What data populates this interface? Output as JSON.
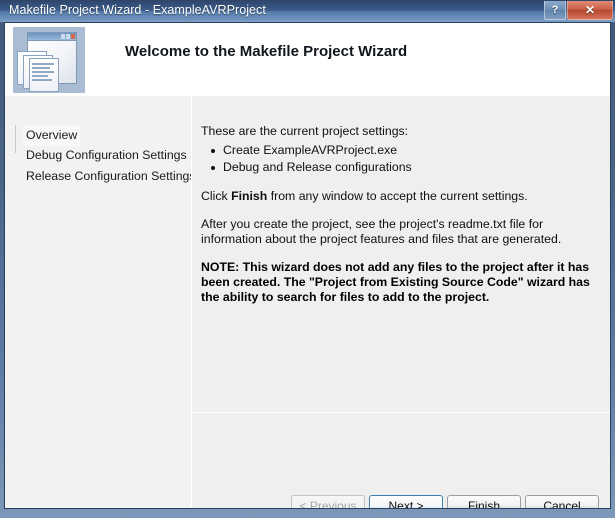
{
  "window": {
    "title": "Makefile Project Wizard - ExampleAVRProject",
    "help_button": "?",
    "close_button": "✕"
  },
  "header": {
    "title": "Welcome to the Makefile Project Wizard",
    "icon": "wizard-window-pages-icon"
  },
  "sidebar": {
    "items": [
      {
        "label": "Overview",
        "selected": true
      },
      {
        "label": "Debug Configuration Settings",
        "selected": false
      },
      {
        "label": "Release Configuration Settings",
        "selected": false
      }
    ]
  },
  "content": {
    "intro": "These are the current project settings:",
    "bullets": [
      "Create ExampleAVRProject.exe",
      "Debug and Release configurations"
    ],
    "click_line_prefix": "Click ",
    "click_line_bold": "Finish",
    "click_line_suffix": " from any window to accept the current settings.",
    "after_create": "After you create the project, see the project's readme.txt file for information about the project features and files that are generated.",
    "note": "NOTE: This wizard does not add any files to the project after it has been created. The \"Project from Existing Source Code\" wizard has the ability to search for files to add to the project."
  },
  "buttons": {
    "previous": "< Previous",
    "next": "Next >",
    "finish": "Finish",
    "cancel": "Cancel"
  },
  "colors": {
    "titlebar_blue": "#3d5d8c",
    "close_red": "#cc5f45",
    "frame_navy": "#29405e",
    "default_button_focus": "#3c7fb1",
    "panel_gray": "#efeff0",
    "sidebar_gray": "#f2f2f2"
  }
}
